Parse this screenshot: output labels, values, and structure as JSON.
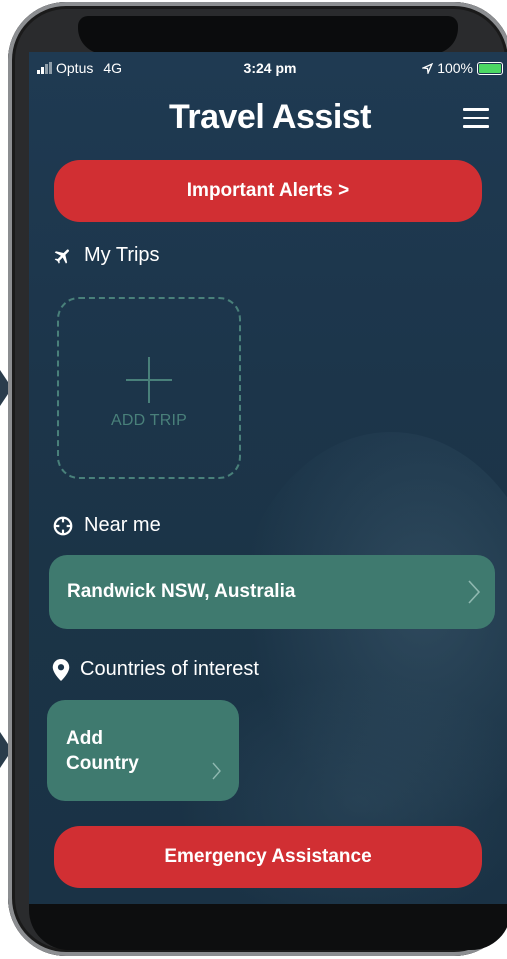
{
  "status_bar": {
    "carrier": "Optus",
    "network": "4G",
    "time": "3:24 pm",
    "battery": "100%"
  },
  "header": {
    "title": "Travel Assist"
  },
  "alerts_button": {
    "label": "Important Alerts >"
  },
  "my_trips": {
    "label": "My Trips",
    "add_trip_label": "ADD TRIP"
  },
  "near_me": {
    "label": "Near me",
    "location": "Randwick NSW, Australia"
  },
  "countries": {
    "label": "Countries of interest",
    "add_line1": "Add",
    "add_line2": "Country"
  },
  "emergency_button": {
    "label": "Emergency Assistance"
  },
  "icons": {
    "menu": "hamburger-menu-icon",
    "plane": "plane-icon",
    "crosshair": "crosshair-icon",
    "pin": "location-pin-icon",
    "chevron": "chevron-right-icon",
    "plus": "plus-icon"
  },
  "colors": {
    "background": "#1c354a",
    "alert_red": "#d12f33",
    "card_teal": "#3f7a6f",
    "dashed_teal": "#49807a"
  }
}
